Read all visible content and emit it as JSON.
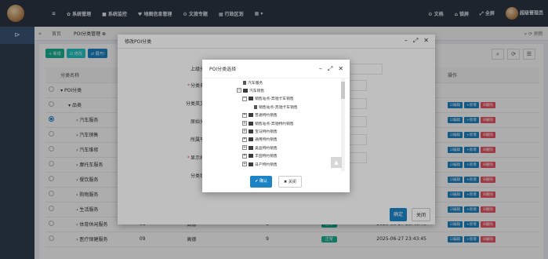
{
  "topbar": {
    "menu": [
      "≡",
      "✿ 系统管理",
      "■ 系统监控",
      "♥ 地图信息管理",
      "⚙ 文旅专题",
      "▦ 行政区划",
      "▦ ▾"
    ],
    "right": [
      "⚙ 文档",
      "⌂ 锁屏",
      "⤢ 全屏",
      "超级管理员"
    ]
  },
  "tabs": {
    "home": "首页",
    "current": "POI分类管理 ⊗",
    "right": "» ⟳ 刷新"
  },
  "toolbar": {
    "add": "+ 新增",
    "edit": "☑ 修改",
    "expand": "⇄ 展开/"
  },
  "table": {
    "columns": [
      "分类名称",
      "",
      "",
      "",
      "",
      "操作"
    ],
    "rows": [
      {
        "name": "▾ POI分类",
        "indent": 0,
        "code": "",
        "level": "",
        "sort": "",
        "status": "",
        "time": "",
        "selected": false
      },
      {
        "name": "▾ 品类",
        "indent": 1,
        "code": "",
        "level": "",
        "sort": "",
        "status": "",
        "time": "",
        "selected": false
      },
      {
        "name": "› 汽车服务",
        "indent": 2,
        "code": "",
        "level": "",
        "sort": "",
        "status": "",
        "time": "43:45",
        "selected": true
      },
      {
        "name": "› 汽车销售",
        "indent": 2,
        "code": "",
        "level": "",
        "sort": "",
        "status": "",
        "time": "43:45",
        "selected": false
      },
      {
        "name": "› 汽车维修",
        "indent": 2,
        "code": "",
        "level": "",
        "sort": "",
        "status": "",
        "time": "43:45",
        "selected": false
      },
      {
        "name": "› 摩托车服务",
        "indent": 2,
        "code": "",
        "level": "",
        "sort": "",
        "status": "",
        "time": "43:45",
        "selected": false
      },
      {
        "name": "› 餐饮服务",
        "indent": 2,
        "code": "",
        "level": "",
        "sort": "",
        "status": "",
        "time": "43:45",
        "selected": false
      },
      {
        "name": "› 购物服务",
        "indent": 2,
        "code": "",
        "level": "",
        "sort": "",
        "status": "",
        "time": "43:45",
        "selected": false
      },
      {
        "name": "› 生活服务",
        "indent": 2,
        "code": "",
        "level": "",
        "sort": "",
        "status": "",
        "time": "43:45",
        "selected": false
      },
      {
        "name": "› 体育休闲服务",
        "indent": 2,
        "code": "08",
        "level": "高德",
        "sort": "8",
        "status": "正常",
        "time": "2025-06-27 23:43:45",
        "selected": false
      },
      {
        "name": "› 医疗保健服务",
        "indent": 2,
        "code": "09",
        "level": "高德",
        "sort": "9",
        "status": "正常",
        "time": "2025-06-27 23:43:45",
        "selected": false
      }
    ],
    "ops": {
      "edit": "☑编辑",
      "add": "+新增",
      "del": "☒删除"
    }
  },
  "dialog_outer": {
    "title": "修改POI分类",
    "labels": {
      "parent": "上级分类：",
      "name": "分类名称：",
      "en": "分类英文名：",
      "orig": "原始分类：",
      "platform": "所属平台：",
      "sort": "显示排序：",
      "status": "分类状态："
    },
    "ok": "确定",
    "close": "关闭"
  },
  "dialog_inner": {
    "title": "POI分类选择",
    "tree": [
      {
        "label": "汽车服务",
        "toggle": "",
        "type": "doc",
        "depth": 0
      },
      {
        "label": "汽车销售",
        "toggle": "−",
        "type": "folder",
        "depth": 0
      },
      {
        "label": "销售站点-奔驰卡车销售",
        "toggle": "−",
        "type": "folder",
        "depth": 1
      },
      {
        "label": "销售站点-奔驰卡车销售",
        "toggle": "",
        "type": "doc",
        "depth": 2
      },
      {
        "label": "普通特约销售",
        "toggle": "+",
        "type": "folder",
        "depth": 1
      },
      {
        "label": "销售站点-奔驰特约销售",
        "toggle": "+",
        "type": "folder",
        "depth": 1
      },
      {
        "label": "宝马特约销售",
        "toggle": "+",
        "type": "folder",
        "depth": 1
      },
      {
        "label": "通用特约销售",
        "toggle": "+",
        "type": "folder",
        "depth": 1
      },
      {
        "label": "奥迪特约销售",
        "toggle": "+",
        "type": "folder",
        "depth": 1
      },
      {
        "label": "丰田特约销售",
        "toggle": "+",
        "type": "folder",
        "depth": 1
      },
      {
        "label": "日产特约销售",
        "toggle": "+",
        "type": "folder",
        "depth": 1
      }
    ],
    "ok": "✔ 确认",
    "close": "✖ 关闭"
  }
}
